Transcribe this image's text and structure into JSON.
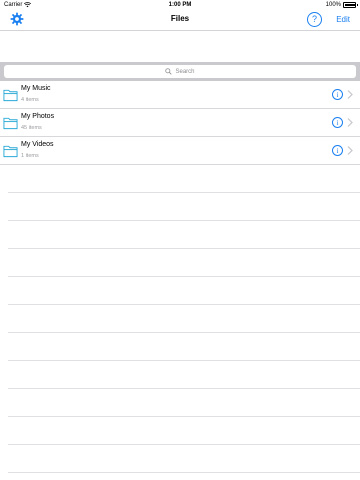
{
  "status": {
    "carrier": "Carrier",
    "time": "1:00 PM",
    "battery": "100%",
    "battery_level": 1.0
  },
  "nav": {
    "title": "Files",
    "help_label": "?",
    "edit_label": "Edit"
  },
  "search": {
    "placeholder": "Search"
  },
  "files": [
    {
      "name": "My Music",
      "count": "4 items"
    },
    {
      "name": "My Photos",
      "count": "45 items"
    },
    {
      "name": "My Videos",
      "count": "1 items"
    }
  ],
  "colors": {
    "accent": "#1a7ff0",
    "folder": "#29a9d6",
    "search_band": "#c9c9ce",
    "separator": "#d8d8dc"
  },
  "icons": {
    "settings": "gear-icon",
    "help": "help-icon",
    "search": "search-icon",
    "folder": "folder-icon",
    "info": "info-icon",
    "disclosure": "chevron-right-icon"
  }
}
